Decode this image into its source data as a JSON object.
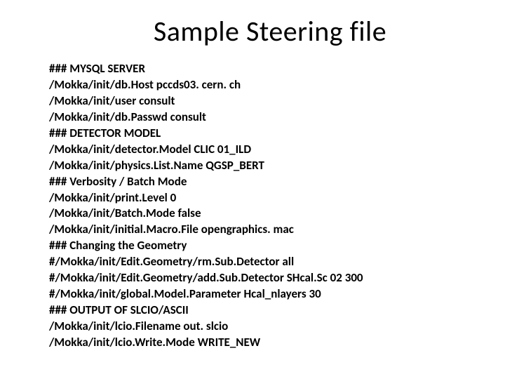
{
  "title": "Sample Steering file",
  "lines": [
    "### MYSQL SERVER",
    "/Mokka/init/db.Host pccds03. cern. ch",
    "/Mokka/init/user consult",
    "/Mokka/init/db.Passwd consult",
    "### DETECTOR MODEL",
    "/Mokka/init/detector.Model CLIC 01_ILD",
    "/Mokka/init/physics.List.Name QGSP_BERT",
    "### Verbosity / Batch Mode",
    "/Mokka/init/print.Level 0",
    "/Mokka/init/Batch.Mode false",
    "/Mokka/init/initial.Macro.File opengraphics. mac",
    "### Changing the Geometry",
    "#/Mokka/init/Edit.Geometry/rm.Sub.Detector all",
    "#/Mokka/init/Edit.Geometry/add.Sub.Detector SHcal.Sc 02 300",
    "#/Mokka/init/global.Model.Parameter Hcal_nlayers 30",
    "### OUTPUT OF SLCIO/ASCII",
    "/Mokka/init/lcio.Filename out. slcio",
    "/Mokka/init/lcio.Write.Mode WRITE_NEW"
  ]
}
